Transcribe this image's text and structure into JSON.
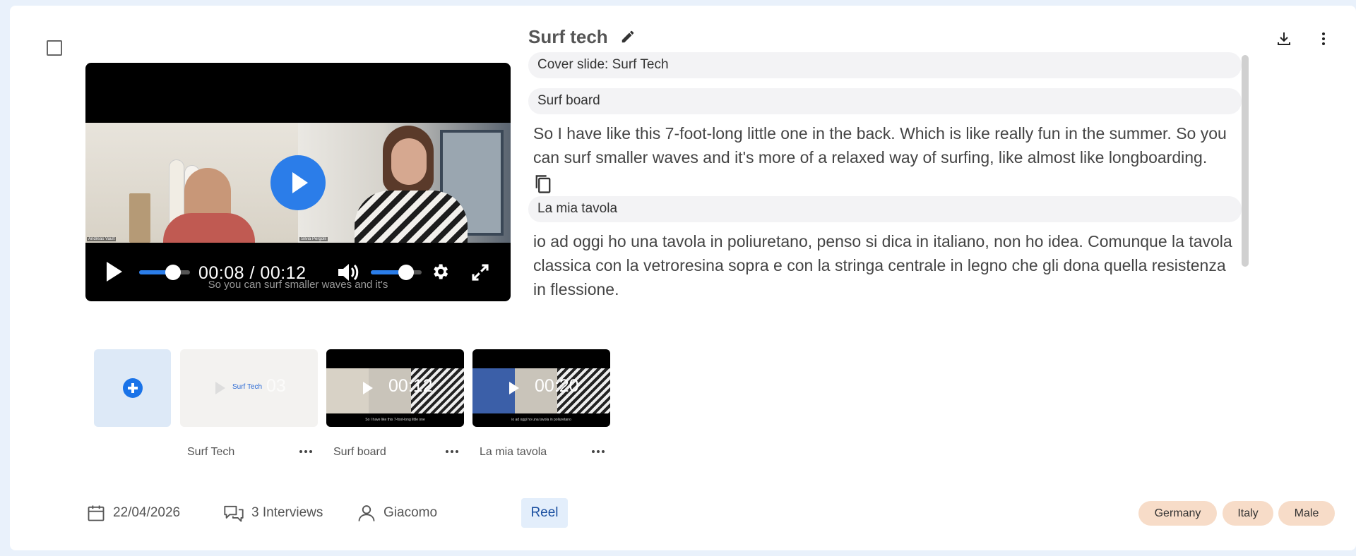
{
  "card": {
    "title": "Surf tech",
    "player": {
      "current_time": "00:08",
      "separator": "/",
      "total_time": "00:12",
      "subtitle": "So you can surf smaller waves and it's",
      "progress_fraction": 0.67,
      "volume_fraction": 0.7,
      "cam_left_label": "Andreas Vault",
      "cam_right_label": "Silvia Pergolli"
    },
    "transcript": [
      {
        "slide": "Cover slide: Surf Tech",
        "text": ""
      },
      {
        "slide": "Surf board",
        "text": "So I have like this 7-foot-long little one in the back. Which is like really fun in the summer. So you can surf smaller waves and it's more of a relaxed way of surfing, like almost like longboarding."
      },
      {
        "slide": "La mia tavola",
        "text": "io ad oggi ho una tavola in poliuretano, penso si dica in italiano, non ho idea. Comunque la tavola classica con la vetroresina sopra e con la stringa centrale in legno che gli dona quella resistenza in flessione."
      }
    ],
    "clips": [
      {
        "label": "Surf Tech",
        "duration": "03",
        "cover_title": "Surf Tech",
        "subtitle": ""
      },
      {
        "label": "Surf board",
        "duration": "00:12",
        "subtitle": "So I have like this 7-foot-long little one"
      },
      {
        "label": "La mia tavola",
        "duration": "00:20",
        "subtitle": "io ad oggi ho una tavola in poliuretano"
      }
    ],
    "meta": {
      "date": "22/04/2026",
      "interviews": "3 Interviews",
      "author": "Giacomo",
      "type_badge": "Reel"
    },
    "tags": [
      "Germany",
      "Italy",
      "Male"
    ],
    "icons": [
      "checkbox-icon",
      "pencil-icon",
      "download-icon",
      "more-vert-icon",
      "copy-icon",
      "add-icon",
      "calendar-icon",
      "chat-icon",
      "user-icon",
      "volume-icon",
      "settings-icon",
      "fullscreen-icon",
      "more-horiz-icon"
    ],
    "colors": {
      "accent": "#2b7de9",
      "tag_bg": "#f7dcc8",
      "reel_bg": "#e3eefb"
    }
  }
}
